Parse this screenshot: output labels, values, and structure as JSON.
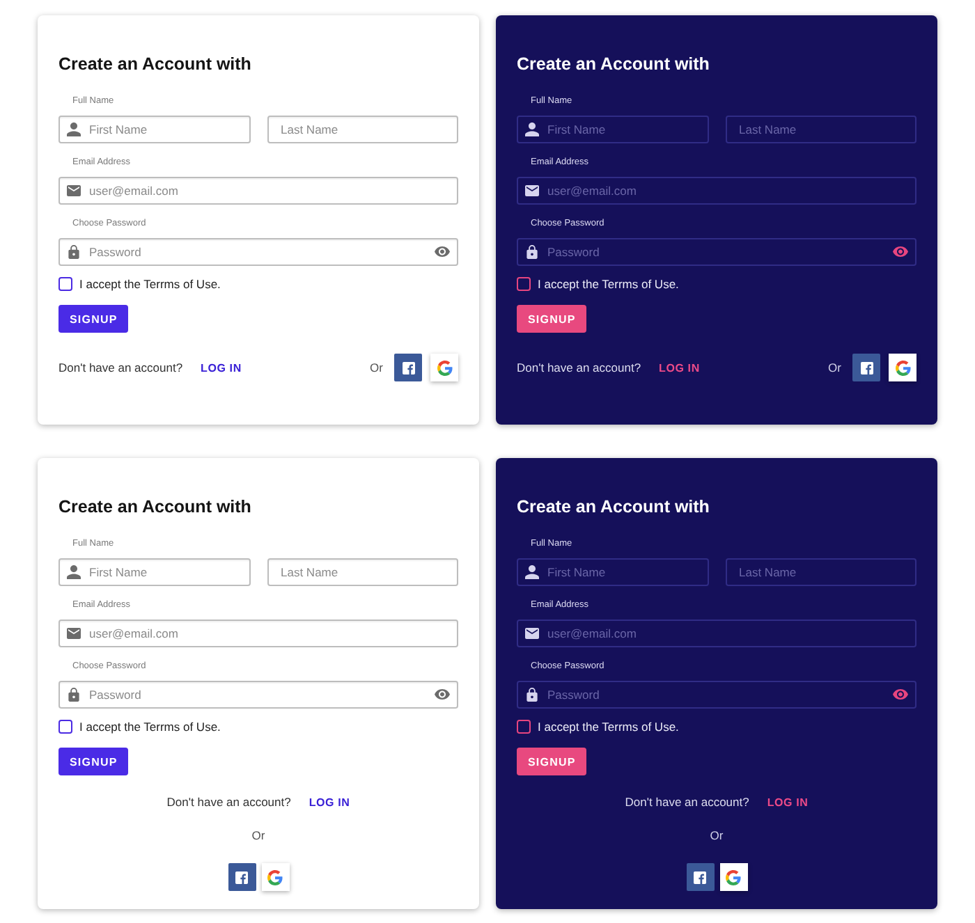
{
  "cards": [
    {
      "kind": "light",
      "title": "Create an Account with",
      "full_name": {
        "label": "Full Name",
        "first_name": {
          "placeholder": "First Name"
        },
        "last_name": {
          "placeholder": "Last Name"
        }
      },
      "email": {
        "label": "Email Address",
        "placeholder": "user@email.com"
      },
      "password": {
        "label": "Choose Password",
        "placeholder": "Password"
      },
      "terms": {
        "label": "I accept the Terrms of Use.",
        "checked": false
      },
      "signup_button": "SIGNUP",
      "footer": {
        "kind": "inline",
        "prompt": "Don't have an account?",
        "login_link": "LOG IN",
        "or_text": "Or"
      }
    },
    {
      "kind": "dark",
      "title": "Create an Account with",
      "full_name": {
        "label": "Full Name",
        "first_name": {
          "placeholder": "First Name"
        },
        "last_name": {
          "placeholder": "Last Name"
        }
      },
      "email": {
        "label": "Email Address",
        "placeholder": "user@email.com"
      },
      "password": {
        "label": "Choose Password",
        "placeholder": "Password"
      },
      "terms": {
        "label": "I accept the Terrms of Use.",
        "checked": false
      },
      "signup_button": "SIGNUP",
      "footer": {
        "kind": "inline",
        "prompt": "Don't have an account?",
        "login_link": "LOG IN",
        "or_text": "Or"
      }
    },
    {
      "kind": "light",
      "title": "Create an Account with",
      "full_name": {
        "label": "Full Name",
        "first_name": {
          "placeholder": "First Name"
        },
        "last_name": {
          "placeholder": "Last Name"
        }
      },
      "email": {
        "label": "Email Address",
        "placeholder": "user@email.com"
      },
      "password": {
        "label": "Choose Password",
        "placeholder": "Password"
      },
      "terms": {
        "label": "I accept the Terrms of Use.",
        "checked": false
      },
      "signup_button": "SIGNUP",
      "footer": {
        "kind": "stacked",
        "prompt": "Don't have an account?",
        "login_link": "LOG IN",
        "or_text": "Or"
      }
    },
    {
      "kind": "dark",
      "title": "Create an Account with",
      "full_name": {
        "label": "Full Name",
        "first_name": {
          "placeholder": "First Name"
        },
        "last_name": {
          "placeholder": "Last Name"
        }
      },
      "email": {
        "label": "Email Address",
        "placeholder": "user@email.com"
      },
      "password": {
        "label": "Choose Password",
        "placeholder": "Password"
      },
      "terms": {
        "label": "I accept the Terrms of Use.",
        "checked": false
      },
      "signup_button": "SIGNUP",
      "footer": {
        "kind": "stacked",
        "prompt": "Don't have an account?",
        "login_link": "LOG IN",
        "or_text": "Or"
      }
    }
  ]
}
